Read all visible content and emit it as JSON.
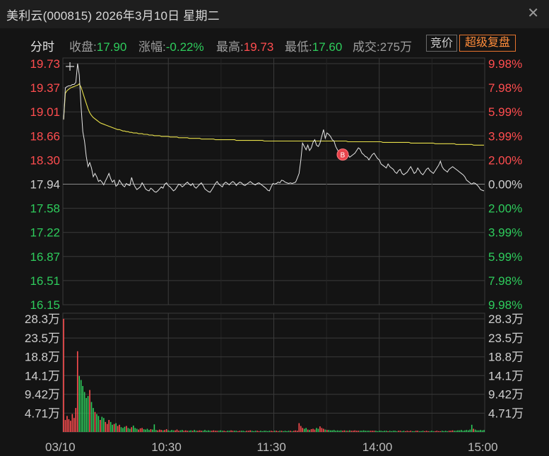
{
  "header": {
    "title": "美利云(000815) 2026年3月10日 星期二",
    "close_icon": "close-icon"
  },
  "infobar": {
    "tab_label": "分时",
    "close_label": "收盘:",
    "close_value": "17.90",
    "change_label": "涨幅:",
    "change_value": "-0.22%",
    "high_label": "最高:",
    "high_value": "19.73",
    "low_label": "最低:",
    "low_value": "17.60",
    "volume_label": "成交:",
    "volume_value": "275万",
    "auction_button": "竞价",
    "super_replay_button": "超级复盘"
  },
  "colors": {
    "up": "#ff4d4f",
    "down": "#2ecc5c",
    "price_line": "#e6e6e6",
    "avg_line": "#e8e04a",
    "grid": "#3a3a3a",
    "background": "#141414"
  },
  "chart_data": {
    "type": "line",
    "prev_close": 17.94,
    "price_ticks_left": [
      "19.73",
      "19.37",
      "19.01",
      "18.66",
      "18.30",
      "17.94",
      "17.58",
      "17.22",
      "16.87",
      "16.51",
      "16.15"
    ],
    "pct_ticks_right": [
      "9.98%",
      "7.98%",
      "5.99%",
      "3.99%",
      "2.00%",
      "0.00%",
      "2.00%",
      "3.99%",
      "5.99%",
      "7.98%",
      "9.98%"
    ],
    "ylim": [
      16.15,
      19.73
    ],
    "volume_ticks": [
      "28.3万",
      "23.5万",
      "18.8万",
      "14.1万",
      "9.42万",
      "4.71万"
    ],
    "volume_ylim": [
      0,
      28.3
    ],
    "x_ticks": [
      "03/10",
      "10:30",
      "11:30",
      "14:00",
      "15:00"
    ],
    "price": [
      18.9,
      19.37,
      19.39,
      19.4,
      19.4,
      19.42,
      19.42,
      19.45,
      19.73,
      19.56,
      19.1,
      18.72,
      18.58,
      18.35,
      18.2,
      18.26,
      18.18,
      18.05,
      18.1,
      18.05,
      17.98,
      18.0,
      17.97,
      17.93,
      17.99,
      18.04,
      18.1,
      18.02,
      17.97,
      18.0,
      17.91,
      17.93,
      18.0,
      17.96,
      17.92,
      17.9,
      17.95,
      17.93,
      17.92,
      18.04,
      17.95,
      17.9,
      17.86,
      17.88,
      17.9,
      17.96,
      17.92,
      17.87,
      17.85,
      17.84,
      17.88,
      17.86,
      17.83,
      17.82,
      17.84,
      17.87,
      17.9,
      17.88,
      17.94,
      17.96,
      17.92,
      17.9,
      17.87,
      17.84,
      17.86,
      17.9,
      17.94,
      17.93,
      17.9,
      17.92,
      17.95,
      17.97,
      17.94,
      17.92,
      17.95,
      17.9,
      17.88,
      17.91,
      17.94,
      17.96,
      17.92,
      17.87,
      17.85,
      17.83,
      17.82,
      17.86,
      17.9,
      17.95,
      17.98,
      17.94,
      17.92,
      17.9,
      17.95,
      17.97,
      17.95,
      17.93,
      17.96,
      17.98,
      17.96,
      17.92,
      17.95,
      17.97,
      17.96,
      17.93,
      17.92,
      17.94,
      17.96,
      17.98,
      17.96,
      17.94,
      17.93,
      17.95,
      17.96,
      17.94,
      17.92,
      17.9,
      17.88,
      17.85,
      17.84,
      17.9,
      17.95,
      17.94,
      17.95,
      17.97,
      17.96,
      18.0,
      17.99,
      17.97,
      17.96,
      17.95,
      17.96,
      17.95,
      17.96,
      17.97,
      18.03,
      18.1,
      18.3,
      18.55,
      18.5,
      18.45,
      18.52,
      18.44,
      18.48,
      18.56,
      18.6,
      18.52,
      18.5,
      18.55,
      18.65,
      18.75,
      18.62,
      18.7,
      18.68,
      18.65,
      18.6,
      18.58,
      18.5,
      18.45,
      18.4,
      18.35,
      18.38,
      18.42,
      18.36,
      18.38,
      18.34,
      18.36,
      18.38,
      18.4,
      18.44,
      18.48,
      18.46,
      18.4,
      18.38,
      18.35,
      18.34,
      18.3,
      18.34,
      18.38,
      18.4,
      18.36,
      18.32,
      18.3,
      18.24,
      18.22,
      18.2,
      18.18,
      18.24,
      18.2,
      18.18,
      18.16,
      18.12,
      18.1,
      18.14,
      18.16,
      18.1,
      18.08,
      18.1,
      18.12,
      18.16,
      18.2,
      18.15,
      18.1,
      18.12,
      18.18,
      18.14,
      18.1,
      18.08,
      18.12,
      18.16,
      18.18,
      18.14,
      18.12,
      18.1,
      18.14,
      18.18,
      18.22,
      18.28,
      18.2,
      18.16,
      18.14,
      18.12,
      18.16,
      18.18,
      18.2,
      18.18,
      18.16,
      18.14,
      18.12,
      18.1,
      18.08,
      18.05,
      18.0,
      17.98,
      17.96,
      17.94,
      17.96,
      17.95,
      17.93,
      17.9,
      17.86,
      17.85,
      17.84,
      17.86,
      17.88,
      17.85,
      17.78,
      17.8,
      17.76,
      17.74,
      17.72,
      17.75,
      17.8,
      17.86,
      17.84,
      17.82,
      17.8,
      17.84,
      17.85,
      17.82,
      17.86,
      17.88,
      17.94,
      17.98,
      17.92,
      17.9,
      17.86,
      17.84,
      17.86,
      17.82,
      17.8,
      17.86,
      17.92,
      18.08,
      18.4,
      18.22,
      18.1,
      17.98,
      17.96,
      17.94,
      17.9,
      17.88,
      17.84,
      17.86,
      17.88,
      17.9
    ],
    "avg_price": [
      18.9,
      19.29,
      19.33,
      19.35,
      19.37,
      19.38,
      19.39,
      19.4,
      19.41,
      19.43,
      19.38,
      19.3,
      19.22,
      19.14,
      19.06,
      19.0,
      18.96,
      18.93,
      18.91,
      18.89,
      18.87,
      18.85,
      18.84,
      18.83,
      18.82,
      18.81,
      18.8,
      18.79,
      18.78,
      18.77,
      18.76,
      18.75,
      18.75,
      18.74,
      18.73,
      18.73,
      18.72,
      18.72,
      18.71,
      18.71,
      18.7,
      18.7,
      18.7,
      18.69,
      18.69,
      18.69,
      18.68,
      18.68,
      18.68,
      18.67,
      18.67,
      18.67,
      18.66,
      18.66,
      18.66,
      18.66,
      18.65,
      18.65,
      18.65,
      18.65,
      18.65,
      18.64,
      18.64,
      18.64,
      18.64,
      18.64,
      18.63,
      18.63,
      18.63,
      18.63,
      18.63,
      18.63,
      18.62,
      18.62,
      18.62,
      18.62,
      18.62,
      18.62,
      18.62,
      18.61,
      18.61,
      18.61,
      18.61,
      18.61,
      18.61,
      18.61,
      18.61,
      18.6,
      18.6,
      18.6,
      18.6,
      18.6,
      18.6,
      18.6,
      18.6,
      18.6,
      18.6,
      18.6,
      18.6,
      18.59,
      18.59,
      18.59,
      18.59,
      18.59,
      18.59,
      18.59,
      18.59,
      18.59,
      18.59,
      18.59,
      18.59,
      18.59,
      18.59,
      18.59,
      18.59,
      18.58,
      18.58,
      18.58,
      18.58,
      18.58,
      18.58,
      18.58,
      18.58,
      18.58,
      18.58,
      18.58,
      18.58,
      18.58,
      18.58,
      18.58,
      18.58,
      18.58,
      18.58,
      18.58,
      18.58,
      18.58,
      18.58,
      18.58,
      18.58,
      18.58,
      18.58,
      18.58,
      18.58,
      18.58,
      18.58,
      18.58,
      18.58,
      18.58,
      18.58,
      18.58,
      18.58,
      18.58,
      18.58,
      18.58,
      18.58,
      18.58,
      18.58,
      18.58,
      18.58,
      18.58,
      18.58,
      18.58,
      18.58,
      18.57,
      18.57,
      18.57,
      18.57,
      18.57,
      18.57,
      18.57,
      18.57,
      18.57,
      18.57,
      18.57,
      18.57,
      18.57,
      18.57,
      18.57,
      18.57,
      18.57,
      18.57,
      18.57,
      18.57,
      18.56,
      18.56,
      18.56,
      18.56,
      18.56,
      18.56,
      18.56,
      18.56,
      18.56,
      18.56,
      18.56,
      18.56,
      18.56,
      18.56,
      18.56,
      18.56,
      18.55,
      18.55,
      18.55,
      18.55,
      18.55,
      18.55,
      18.55,
      18.55,
      18.55,
      18.55,
      18.55,
      18.55,
      18.55,
      18.55,
      18.54,
      18.54,
      18.54,
      18.54,
      18.54,
      18.54,
      18.54,
      18.54,
      18.54,
      18.54,
      18.54,
      18.54,
      18.53,
      18.53,
      18.53,
      18.53,
      18.53,
      18.53,
      18.53,
      18.53,
      18.53,
      18.53,
      18.52,
      18.52,
      18.52,
      18.52,
      18.52,
      18.52,
      18.52,
      18.52,
      18.51,
      18.51,
      18.51,
      18.51,
      18.51,
      18.51,
      18.51,
      18.5,
      18.5,
      18.5,
      18.5,
      18.5,
      18.5,
      18.49,
      18.49,
      18.49,
      18.49,
      18.49,
      18.48,
      18.48,
      18.48,
      18.48,
      18.48,
      18.47,
      18.47,
      18.47,
      18.47,
      18.47,
      18.46,
      18.46,
      18.46,
      18.46,
      18.45,
      18.45,
      18.45,
      18.45,
      18.44,
      18.44,
      18.44,
      18.44,
      18.43,
      18.43,
      18.43,
      18.42,
      18.42
    ],
    "volume": [
      28.3,
      3.0,
      4.0,
      3.2,
      2.8,
      4.5,
      3.5,
      6.0,
      20.2,
      14.0,
      13.0,
      11.5,
      10.0,
      8.5,
      9.0,
      10.5,
      7.5,
      6.0,
      5.0,
      4.5,
      4.0,
      3.0,
      3.8,
      3.5,
      2.5,
      2.0,
      3.0,
      2.5,
      1.8,
      2.0,
      2.2,
      1.5,
      1.8,
      1.2,
      1.0,
      1.3,
      1.5,
      1.0,
      0.8,
      1.2,
      1.6,
      1.0,
      0.8,
      0.6,
      0.9,
      1.0,
      0.7,
      0.6,
      0.8,
      0.5,
      0.7,
      0.6,
      1.9,
      0.5,
      0.4,
      0.6,
      0.5,
      0.4,
      0.5,
      0.7,
      0.4,
      0.3,
      0.5,
      0.4,
      0.4,
      0.6,
      0.3,
      0.4,
      0.5,
      0.3,
      0.4,
      0.3,
      0.3,
      0.4,
      0.3,
      0.5,
      0.3,
      0.3,
      0.4,
      0.3,
      0.3,
      0.5,
      0.3,
      0.4,
      0.3,
      0.3,
      0.4,
      0.3,
      0.3,
      0.3,
      0.4,
      0.3,
      0.3,
      0.2,
      0.3,
      0.3,
      0.4,
      0.3,
      0.3,
      0.3,
      0.2,
      0.3,
      0.3,
      0.3,
      0.2,
      0.3,
      0.3,
      0.4,
      0.3,
      0.2,
      0.3,
      0.3,
      0.2,
      0.3,
      0.2,
      0.3,
      0.3,
      0.2,
      0.3,
      0.3,
      0.2,
      0.3,
      0.3,
      0.2,
      0.3,
      0.3,
      0.2,
      0.3,
      0.2,
      0.3,
      0.3,
      0.2,
      0.3,
      0.4,
      0.3,
      2.2,
      1.5,
      1.0,
      0.8,
      1.0,
      0.6,
      0.5,
      0.7,
      0.8,
      0.6,
      1.0,
      0.8,
      1.4,
      1.0,
      0.8,
      0.6,
      0.5,
      0.5,
      0.4,
      0.4,
      0.5,
      0.3,
      0.4,
      0.3,
      0.4,
      0.3,
      0.4,
      0.3,
      0.3,
      0.4,
      0.3,
      0.3,
      0.4,
      0.3,
      0.3,
      0.3,
      0.3,
      0.4,
      0.3,
      0.3,
      0.3,
      0.3,
      0.3,
      0.3,
      0.3,
      0.2,
      0.3,
      0.3,
      0.2,
      0.3,
      0.3,
      0.2,
      0.3,
      0.2,
      0.3,
      0.3,
      0.2,
      0.3,
      0.3,
      0.2,
      0.3,
      0.2,
      0.3,
      0.2,
      0.3,
      0.2,
      0.2,
      0.3,
      0.3,
      0.2,
      0.2,
      0.3,
      0.2,
      0.3,
      0.2,
      0.2,
      0.3,
      0.2,
      0.2,
      0.3,
      0.2,
      0.2,
      0.3,
      0.2,
      0.3,
      0.2,
      0.3,
      0.3,
      0.4,
      0.3,
      0.3,
      0.4,
      0.4,
      0.5,
      0.3,
      0.4,
      0.5,
      0.4,
      0.6,
      1.8,
      0.8,
      0.6,
      0.4,
      0.4,
      0.5,
      0.4,
      0.5,
      0.4,
      0.6,
      0.5,
      0.6,
      0.7,
      0.8,
      0.9,
      1.0,
      1.2,
      1.4,
      1.6,
      2.0,
      3.5,
      2.5,
      2.0,
      1.6,
      1.8,
      2.2,
      2.5,
      3.0,
      3.2,
      6.5
    ],
    "marker_label": "B"
  }
}
